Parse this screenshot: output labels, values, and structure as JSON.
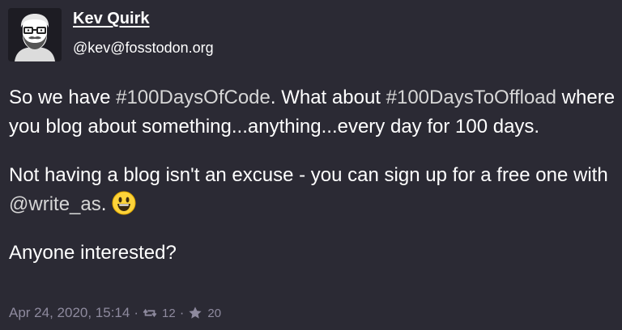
{
  "author": {
    "display_name": "Kev Quirk",
    "handle": "@kev@fosstodon.org",
    "avatar_icon": "bearded-man-glasses-avatar"
  },
  "post": {
    "p1_text_1": "So we have ",
    "p1_hashtag_1": "#100DaysOfCode",
    "p1_text_2": ". What about ",
    "p1_hashtag_2": "#100DaysToOffload",
    "p1_text_3": " where you blog about something...anything...every day for 100 days.",
    "p2_text_1": "Not having a blog isn't an excuse - you can sign up for a free one with ",
    "p2_mention": "@write_as",
    "p2_text_2": ".",
    "p2_emoji": "smiling-face-emoji",
    "p3_text": "Anyone interested?"
  },
  "meta": {
    "date": "Apr 24, 2020, 15:14",
    "separator": "·",
    "boost_icon": "boost-icon",
    "boosts": "12",
    "favourite_icon": "star-icon",
    "favourites": "20"
  },
  "colors": {
    "background": "#2b2a34",
    "text": "#ffffff",
    "muted": "#8e8a9e"
  }
}
